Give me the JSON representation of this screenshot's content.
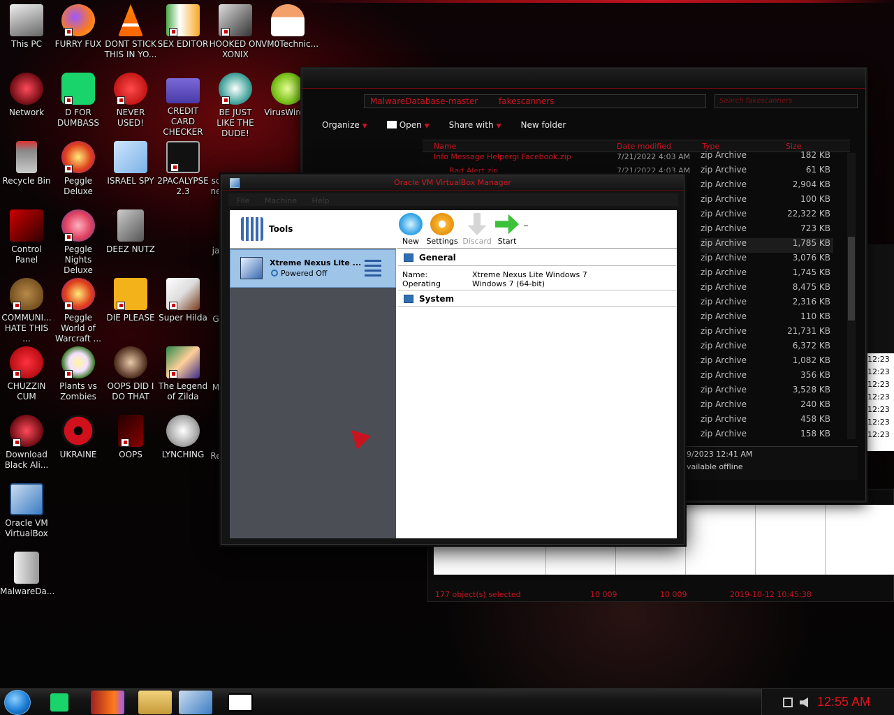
{
  "desktop_icons": [
    {
      "label": "This PC"
    },
    {
      "label": "FURRY FUX"
    },
    {
      "label": "DONT STICK THIS IN YO..."
    },
    {
      "label": "SEX EDITOR"
    },
    {
      "label": "HOOKED ON XONIX"
    },
    {
      "label": "VM0Technic..."
    },
    {
      "label": "Network"
    },
    {
      "label": "D FOR DUMBASS"
    },
    {
      "label": "NEVER USED!"
    },
    {
      "label": "CREDIT CARD CHECKER"
    },
    {
      "label": "BE JUST LIKE THE DUDE!"
    },
    {
      "label": "VirusWire.c"
    },
    {
      "label": "Recycle Bin"
    },
    {
      "label": "Peggle Deluxe"
    },
    {
      "label": "ISRAEL SPY"
    },
    {
      "label": "2PACALYPSE 2.3"
    },
    {
      "label": "sc ne"
    },
    {
      "label": "Control Panel"
    },
    {
      "label": "Peggle Nights Deluxe"
    },
    {
      "label": "DEEZ NUTZ"
    },
    {
      "label": "ja"
    },
    {
      "label": "COMMUNI... HATE THIS ..."
    },
    {
      "label": "Peggle World of Warcraft ..."
    },
    {
      "label": "DIE PLEASE"
    },
    {
      "label": "Super Hilda"
    },
    {
      "label": "G"
    },
    {
      "label": "CHUZZIN CUM"
    },
    {
      "label": "Plants vs Zombies"
    },
    {
      "label": "OOPS DID I DO THAT"
    },
    {
      "label": "The Legend of Zilda"
    },
    {
      "label": "M"
    },
    {
      "label": "Download Black Ali..."
    },
    {
      "label": "UKRAINE"
    },
    {
      "label": "OOPS"
    },
    {
      "label": "LYNCHING"
    },
    {
      "label": "Re"
    },
    {
      "label": "Oracle VM VirtualBox"
    },
    {
      "label": "MalwareDa..."
    }
  ],
  "explorer": {
    "breadcrumb": [
      "MalwareDatabase-master",
      "fakescanners"
    ],
    "search_placeholder": "Search fakescanners",
    "toolbar": {
      "organize": "Organize",
      "open": "Open",
      "share": "Share with",
      "new_folder": "New folder"
    },
    "columns": {
      "name": "Name",
      "date": "Date modified",
      "type": "Type",
      "size": "Size"
    },
    "partial_rows": [
      {
        "name": "Info Message Helpergi Facebook.zip",
        "date": "7/21/2022 4:03 AM"
      },
      {
        "name": "Bad Alert.zip",
        "date": "7/21/2022 4:03 AM"
      }
    ],
    "rows": [
      {
        "type": "zip Archive",
        "size": "182 KB"
      },
      {
        "type": "zip Archive",
        "size": "61 KB"
      },
      {
        "type": "zip Archive",
        "size": "2,904 KB"
      },
      {
        "type": "zip Archive",
        "size": "100 KB"
      },
      {
        "type": "zip Archive",
        "size": "22,322 KB"
      },
      {
        "type": "zip Archive",
        "size": "723 KB"
      },
      {
        "type": "zip Archive",
        "size": "1,785 KB"
      },
      {
        "type": "zip Archive",
        "size": "3,076 KB"
      },
      {
        "type": "zip Archive",
        "size": "1,745 KB"
      },
      {
        "type": "zip Archive",
        "size": "8,475 KB"
      },
      {
        "type": "zip Archive",
        "size": "2,316 KB"
      },
      {
        "type": "zip Archive",
        "size": "110 KB"
      },
      {
        "type": "zip Archive",
        "size": "21,731 KB"
      },
      {
        "type": "zip Archive",
        "size": "6,372 KB"
      },
      {
        "type": "zip Archive",
        "size": "1,082 KB"
      },
      {
        "type": "zip Archive",
        "size": "356 KB"
      },
      {
        "type": "zip Archive",
        "size": "3,528 KB"
      },
      {
        "type": "zip Archive",
        "size": "240 KB"
      },
      {
        "type": "zip Archive",
        "size": "458 KB"
      },
      {
        "type": "zip Archive",
        "size": "158 KB"
      }
    ],
    "details_date": "9/2023 12:41 AM",
    "details_offline": "vailable offline"
  },
  "bg_window": {
    "status_selected": "177 object(s) selected",
    "status_a": "10 009",
    "status_b": "10 009",
    "status_date": "2019-10-12 10:45:38",
    "times": [
      "12:23",
      "12:23",
      "12:23",
      "12:23",
      "12:23",
      "12:23",
      "12:23"
    ]
  },
  "vbox": {
    "title": "Oracle VM VirtualBox Manager",
    "menu": {
      "file": "File",
      "machine": "Machine",
      "help": "Help"
    },
    "tools_label": "Tools",
    "vm": {
      "name": "Xtreme Nexus Lite ...",
      "state": "Powered Off"
    },
    "actions": {
      "new": "New",
      "settings": "Settings",
      "discard": "Discard",
      "start": "Start"
    },
    "general": {
      "header": "General",
      "name_key": "Name:",
      "name_val": "Xtreme Nexus Lite Windows 7",
      "os_key": "Operating System:",
      "os_val": "Windows 7 (64-bit)"
    },
    "system": {
      "header": "System"
    }
  },
  "taskbar": {
    "clock": "12:55 AM"
  },
  "colors": {
    "accent_red": "#c91420",
    "vm_selected": "#9ec4e8"
  }
}
